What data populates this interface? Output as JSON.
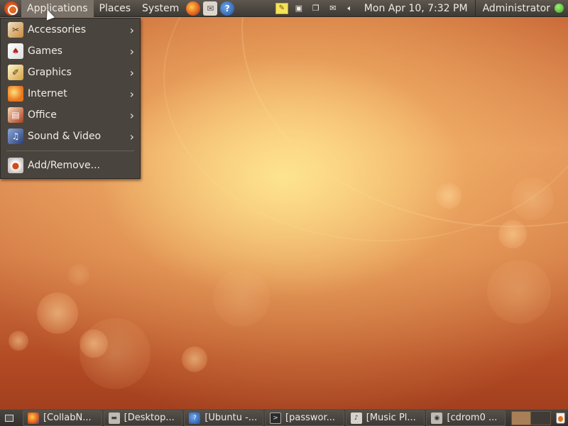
{
  "top_panel": {
    "menus": {
      "applications": "Applications",
      "places": "Places",
      "system": "System"
    },
    "launchers": [
      "firefox-icon",
      "evolution-mail-icon",
      "help-icon"
    ],
    "tray_icons": [
      "notes-icon",
      "network-icon",
      "window-icon",
      "mail-icon",
      "volume-icon"
    ],
    "clock": "Mon Apr 10,  7:32 PM",
    "user": "Administrator",
    "status_color": "#3da41a"
  },
  "applications_menu": {
    "items": [
      {
        "label": "Accessories",
        "icon": "accessories-icon",
        "submenu": true
      },
      {
        "label": "Games",
        "icon": "games-icon",
        "submenu": true
      },
      {
        "label": "Graphics",
        "icon": "graphics-icon",
        "submenu": true
      },
      {
        "label": "Internet",
        "icon": "internet-icon",
        "submenu": true
      },
      {
        "label": "Office",
        "icon": "office-icon",
        "submenu": true
      },
      {
        "label": "Sound & Video",
        "icon": "sound-video-icon",
        "submenu": true
      }
    ],
    "add_remove": {
      "label": "Add/Remove...",
      "icon": "add-remove-icon"
    }
  },
  "bottom_panel": {
    "tasks": [
      {
        "label": "[CollabN...",
        "icon": "firefox-icon"
      },
      {
        "label": "[Desktop...",
        "icon": "folder-icon"
      },
      {
        "label": "[Ubuntu -...",
        "icon": "help-icon"
      },
      {
        "label": "[passwor...",
        "icon": "terminal-icon"
      },
      {
        "label": "[Music Pl...",
        "icon": "music-player-icon"
      },
      {
        "label": "[cdrom0 ...",
        "icon": "cdrom-icon"
      }
    ]
  },
  "colors": {
    "panel": "#3d3934",
    "menu_bg": "#4a443e",
    "accent_orange": "#e06a25"
  }
}
